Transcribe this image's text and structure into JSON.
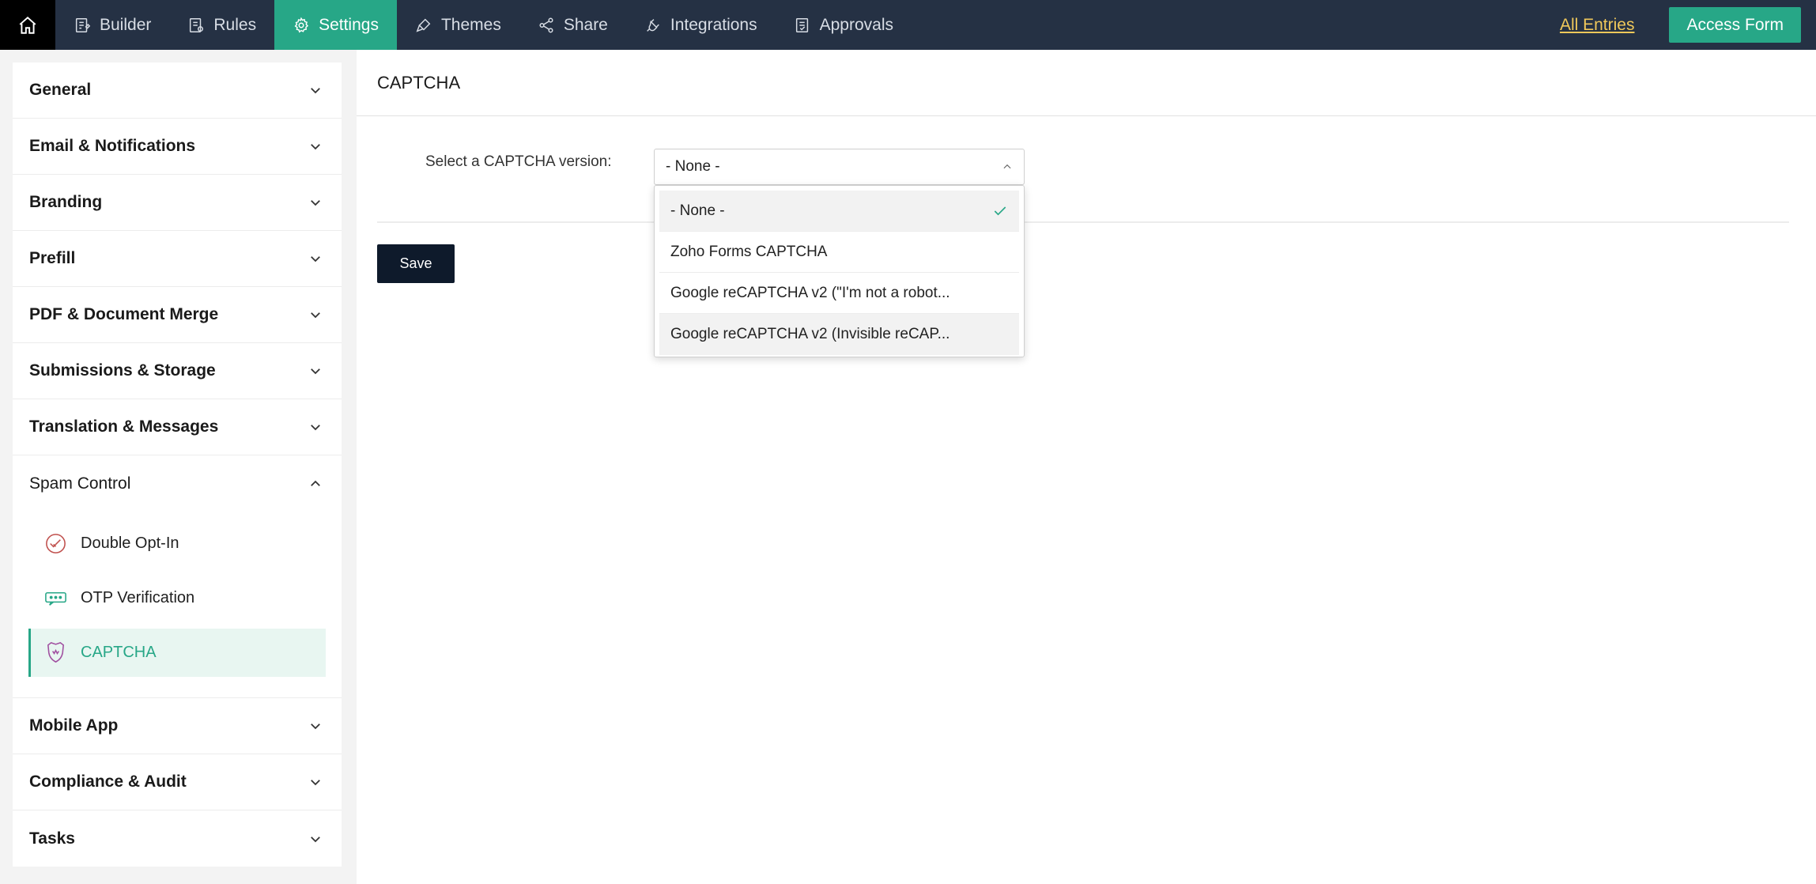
{
  "topbar": {
    "nav": [
      {
        "label": "Builder",
        "icon": "builder-icon"
      },
      {
        "label": "Rules",
        "icon": "rules-icon"
      },
      {
        "label": "Settings",
        "icon": "gear-icon",
        "active": true
      },
      {
        "label": "Themes",
        "icon": "brush-icon"
      },
      {
        "label": "Share",
        "icon": "share-icon"
      },
      {
        "label": "Integrations",
        "icon": "plug-icon"
      },
      {
        "label": "Approvals",
        "icon": "approvals-icon"
      }
    ],
    "all_entries": "All Entries",
    "access_form": "Access Form"
  },
  "sidebar": {
    "sections": [
      "General",
      "Email & Notifications",
      "Branding",
      "Prefill",
      "PDF & Document Merge",
      "Submissions & Storage",
      "Translation & Messages",
      "Spam Control",
      "Mobile App",
      "Compliance & Audit",
      "Tasks"
    ],
    "spam_items": [
      "Double Opt-In",
      "OTP Verification",
      "CAPTCHA"
    ]
  },
  "main": {
    "title": "CAPTCHA",
    "field_label": "Select a CAPTCHA version:",
    "selected_value": "- None -",
    "options": [
      "- None -",
      "Zoho Forms CAPTCHA",
      "Google reCAPTCHA v2 (\"I'm not a robot...",
      "Google reCAPTCHA v2 (Invisible reCAP..."
    ],
    "save": "Save"
  },
  "colors": {
    "topbar": "#253144",
    "accent": "#27a787",
    "link": "#f0c85a",
    "save_button": "#0e1a2b"
  }
}
